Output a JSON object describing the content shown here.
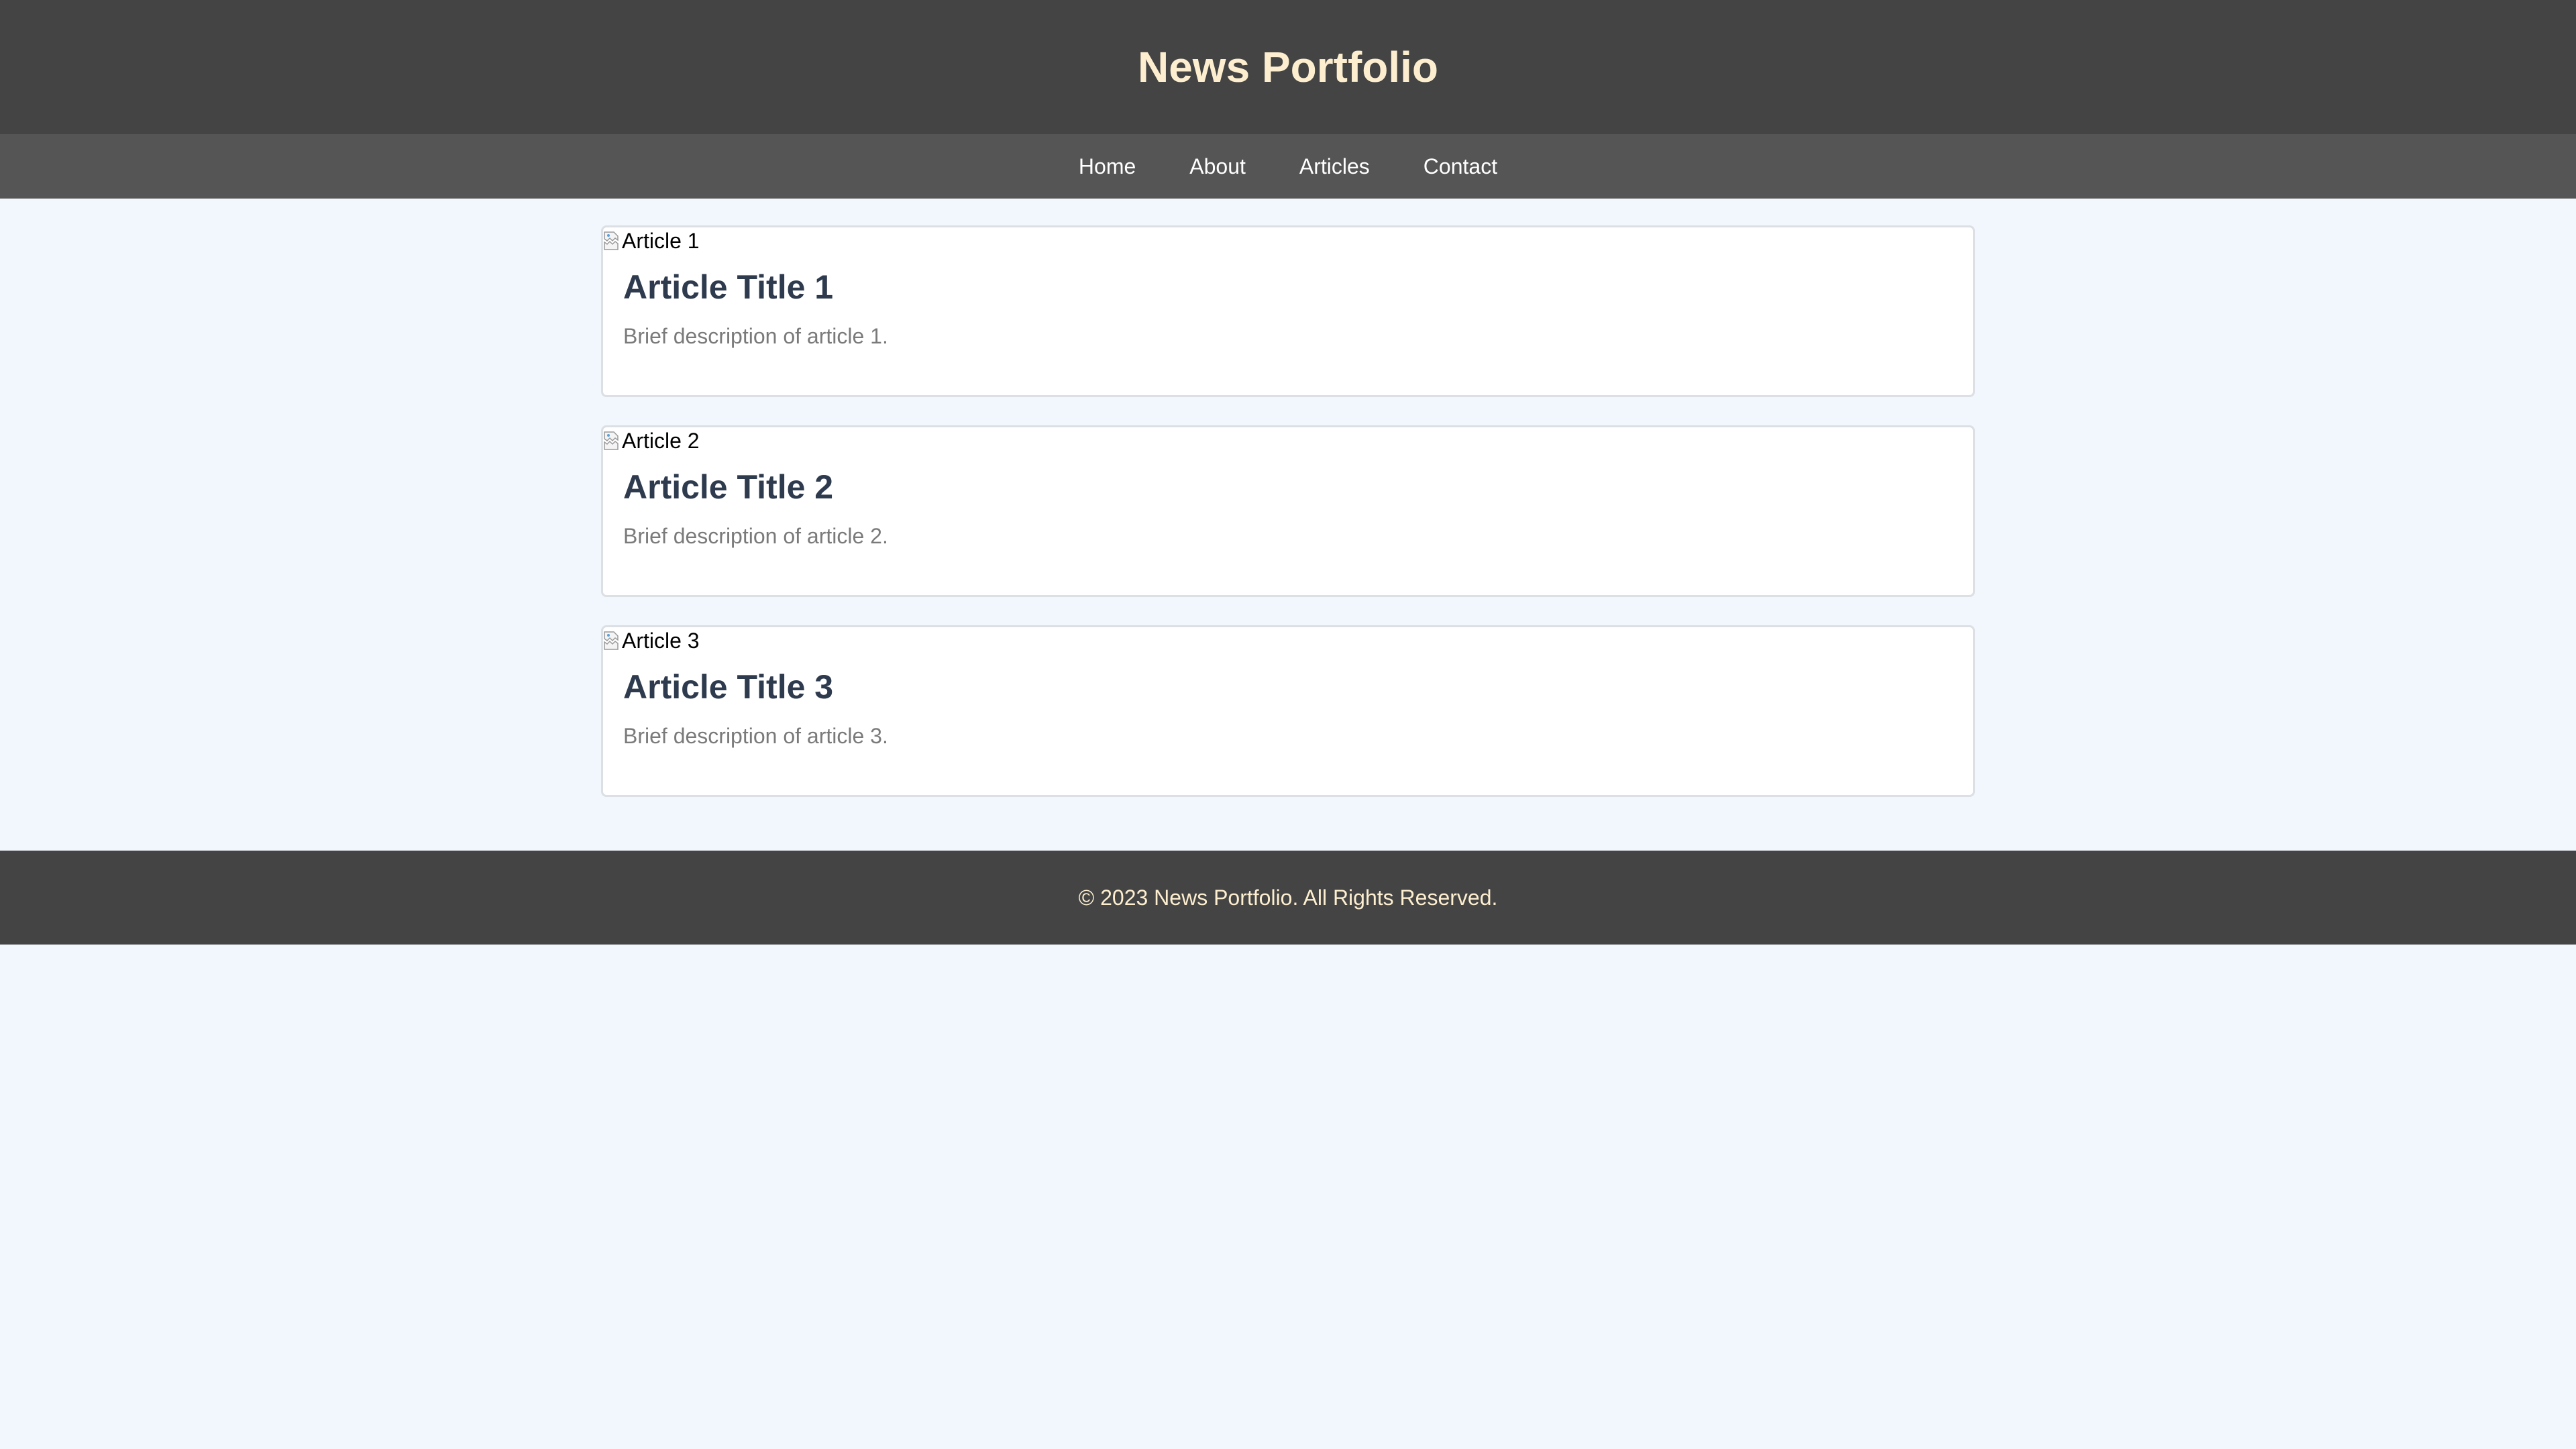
{
  "header": {
    "title": "News Portfolio"
  },
  "nav": {
    "items": [
      {
        "label": "Home"
      },
      {
        "label": "About"
      },
      {
        "label": "Articles"
      },
      {
        "label": "Contact"
      }
    ]
  },
  "articles": [
    {
      "image_alt": "Article 1",
      "title": "Article Title 1",
      "description": "Brief description of article 1."
    },
    {
      "image_alt": "Article 2",
      "title": "Article Title 2",
      "description": "Brief description of article 2."
    },
    {
      "image_alt": "Article 3",
      "title": "Article Title 3",
      "description": "Brief description of article 3."
    }
  ],
  "footer": {
    "text": "© 2023 News Portfolio. All Rights Reserved."
  },
  "colors": {
    "header_bg": "#444444",
    "nav_bg": "#555555",
    "title_color": "#fdeecf",
    "page_bg": "#f2f7fd",
    "article_title_color": "#2e3a4d"
  },
  "icons": {
    "broken_image": "broken-image-icon"
  }
}
